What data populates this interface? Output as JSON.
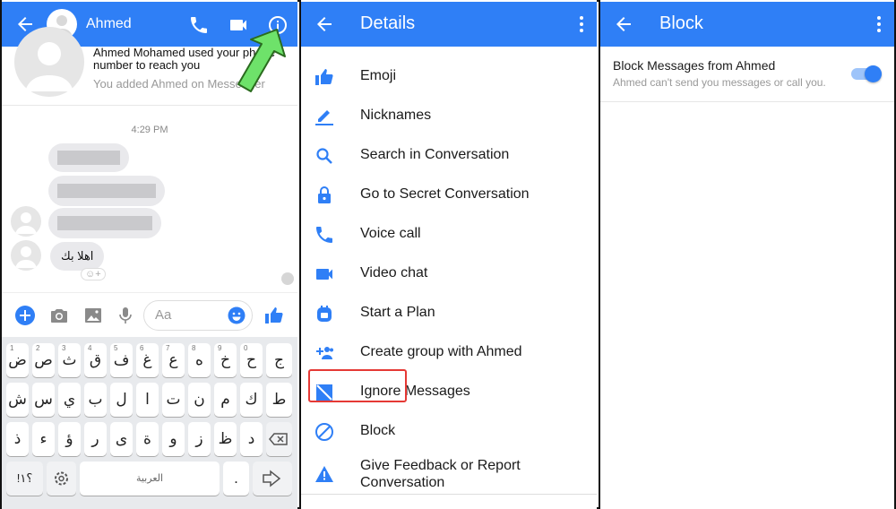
{
  "colors": {
    "accent": "#2f7ff6",
    "highlight": "#e53935",
    "arrow": "#6ee26a"
  },
  "panel1": {
    "contact_name": "Ahmed",
    "info_line1": "Ahmed Mohamed used your phone number to reach you",
    "info_line2": "You added Ahmed on Messenger",
    "timestamp": "4:29 PM",
    "arabic_message": "اهلا بك",
    "input_placeholder": "Aa",
    "keyboard": {
      "row1": [
        "ض",
        "ص",
        "ث",
        "ق",
        "ف",
        "غ",
        "ع",
        "ه",
        "خ",
        "ح",
        "ج"
      ],
      "row1_hints": [
        "1",
        "2",
        "3",
        "4",
        "5",
        "6",
        "7",
        "8",
        "9",
        "0",
        ""
      ],
      "row2": [
        "ش",
        "س",
        "ي",
        "ب",
        "ل",
        "ا",
        "ت",
        "ن",
        "م",
        "ك",
        "ط"
      ],
      "row3": [
        "ذ",
        "ء",
        "ؤ",
        "ر",
        "ى",
        "ة",
        "و",
        "ز",
        "ظ",
        "د"
      ],
      "symbols_key": "!؟١",
      "space_label": "العربية",
      "period_key": "."
    }
  },
  "panel2": {
    "title": "Details",
    "items": [
      {
        "label": "Emoji",
        "icon": "thumbs-up-icon"
      },
      {
        "label": "Nicknames",
        "icon": "pencil-icon"
      },
      {
        "label": "Search in Conversation",
        "icon": "search-icon"
      },
      {
        "label": "Go to Secret Conversation",
        "icon": "lock-icon"
      },
      {
        "label": "Voice call",
        "icon": "phone-icon"
      },
      {
        "label": "Video chat",
        "icon": "video-icon"
      },
      {
        "label": "Start a Plan",
        "icon": "calendar-icon"
      },
      {
        "label": "Create group with Ahmed",
        "icon": "group-add-icon"
      },
      {
        "label": "Ignore Messages",
        "icon": "ignore-icon"
      },
      {
        "label": "Block",
        "icon": "block-icon"
      },
      {
        "label": "Give Feedback or Report Conversation",
        "icon": "warning-icon"
      }
    ]
  },
  "panel3": {
    "title": "Block",
    "setting_title": "Block Messages from Ahmed",
    "setting_subtitle": "Ahmed can't send you messages or call you.",
    "toggle_on": true
  }
}
